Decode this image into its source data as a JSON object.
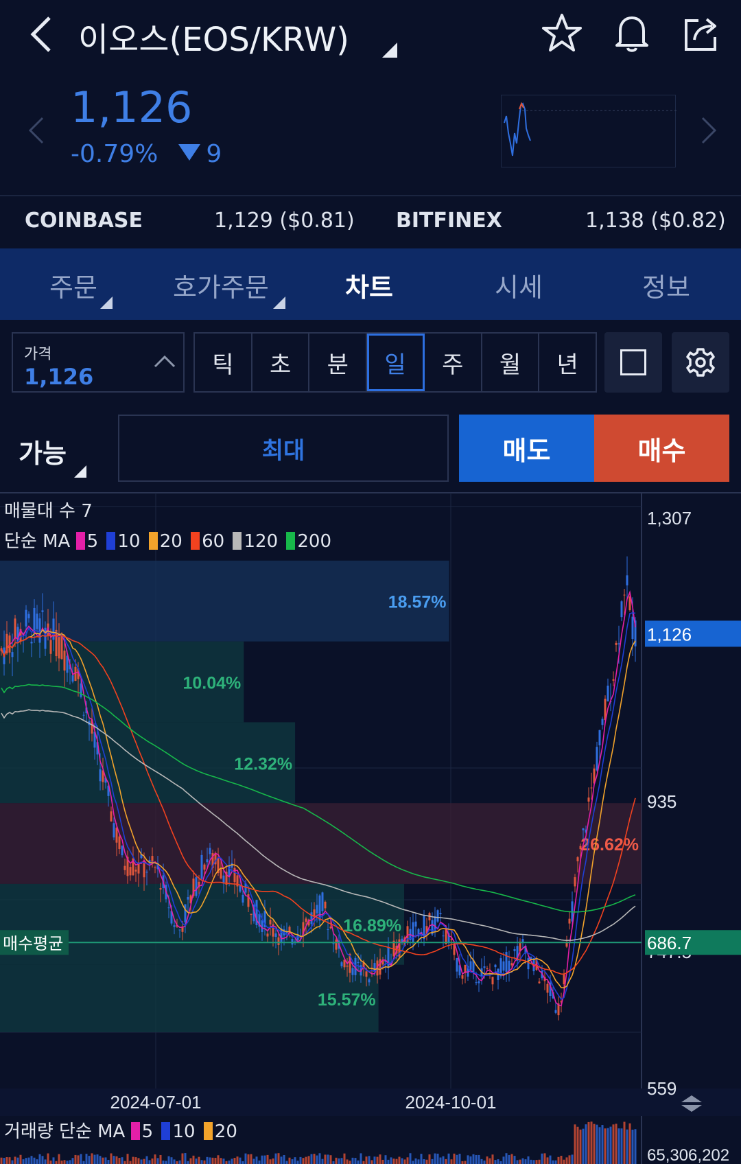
{
  "header": {
    "title": "이오스(EOS/KRW)"
  },
  "ticker": {
    "price": "1,126",
    "change_pct": "-0.79%",
    "change_abs": "9"
  },
  "exchanges": [
    {
      "name": "COINBASE",
      "value": "1,129 ($0.81)"
    },
    {
      "name": "BITFINEX",
      "value": "1,138 ($0.82)"
    }
  ],
  "tabs": [
    {
      "label": "주문",
      "active": false,
      "has_menu": true
    },
    {
      "label": "호가주문",
      "active": false,
      "has_menu": true
    },
    {
      "label": "차트",
      "active": true,
      "has_menu": false
    },
    {
      "label": "시세",
      "active": false,
      "has_menu": false
    },
    {
      "label": "정보",
      "active": false,
      "has_menu": false
    }
  ],
  "price_selector": {
    "label": "가격",
    "value": "1,126"
  },
  "periods": [
    {
      "label": "틱",
      "active": false
    },
    {
      "label": "초",
      "active": false
    },
    {
      "label": "분",
      "active": false
    },
    {
      "label": "일",
      "active": true
    },
    {
      "label": "주",
      "active": false
    },
    {
      "label": "월",
      "active": false
    },
    {
      "label": "년",
      "active": false
    }
  ],
  "order_bar": {
    "available_label": "가능",
    "max_label": "최대",
    "sell_label": "매도",
    "buy_label": "매수"
  },
  "colors": {
    "background": "#0a1128",
    "accent_blue": "#1764d2",
    "accent_red": "#cf4a31",
    "up_candle": "#e0573c",
    "down_candle": "#2f6fe0",
    "avg_price": "#1e9a77"
  },
  "chart_data": {
    "type": "candlestick",
    "volume_profile_label": "매물대 수 7",
    "ma_label": "단순 MA",
    "ma_series": [
      {
        "name": "5",
        "color": "#e41fa8"
      },
      {
        "name": "10",
        "color": "#1f3fd6"
      },
      {
        "name": "20",
        "color": "#f2a32b"
      },
      {
        "name": "60",
        "color": "#f2421f"
      },
      {
        "name": "120",
        "color": "#b8b8b8"
      },
      {
        "name": "200",
        "color": "#17b84a"
      }
    ],
    "y_ticks": [
      "1,307",
      "935",
      "747.5",
      "559"
    ],
    "y_tick_values": [
      1307,
      935,
      747.5,
      559
    ],
    "ylim": [
      559,
      1307
    ],
    "x_ticks": [
      "2024-07-01",
      "2024-10-01"
    ],
    "current_price": {
      "label": "1,126",
      "value": 1126
    },
    "avg_buy_price": {
      "label": "매수평균",
      "value_label": "686.7",
      "value": 686.7
    },
    "volume_profile": [
      {
        "pct": "18.57%",
        "low": 1115,
        "high": 1230,
        "share": 0.7
      },
      {
        "pct": "10.04%",
        "low": 1000,
        "high": 1115,
        "share": 0.38
      },
      {
        "pct": "12.32%",
        "low": 885,
        "high": 1000,
        "share": 0.46
      },
      {
        "pct": "26.62%",
        "low": 770,
        "high": 885,
        "share": 1.0
      },
      {
        "pct": "16.89%",
        "low": 655,
        "high": 770,
        "share": 0.63
      },
      {
        "pct": "15.57%",
        "low": 559,
        "high": 655,
        "share": 0.59
      }
    ],
    "volume": {
      "label": "거래량 단순 MA",
      "ma_series": [
        {
          "name": "5",
          "color": "#e41fa8"
        },
        {
          "name": "10",
          "color": "#1f3fd6"
        },
        {
          "name": "20",
          "color": "#f2a32b"
        }
      ],
      "max_label": "65,306,202"
    }
  }
}
